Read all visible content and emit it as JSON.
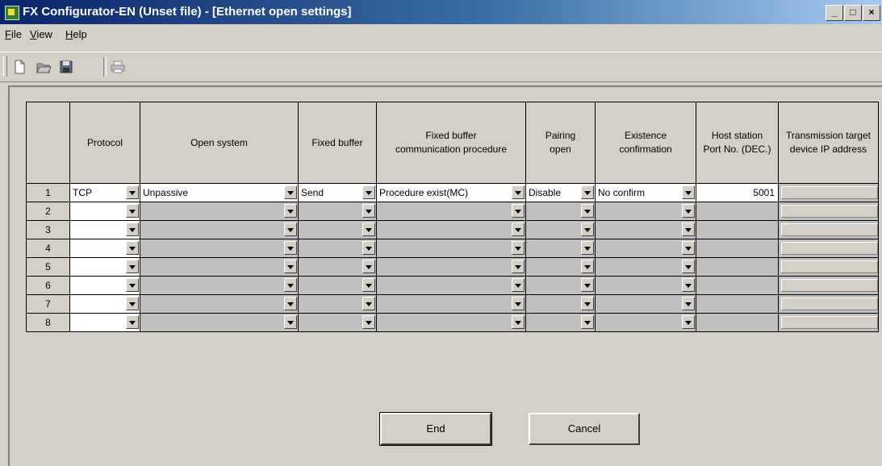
{
  "window": {
    "title": "FX Configurator-EN (Unset file) - [Ethernet open settings]"
  },
  "menu": [
    {
      "label_u": "F",
      "label_rest": "ile"
    },
    {
      "label_u": "V",
      "label_rest": "iew"
    },
    {
      "label_u": "H",
      "label_rest": "elp"
    }
  ],
  "table": {
    "headers": [
      "",
      "Protocol",
      "Open system",
      "Fixed buffer",
      "Fixed buffer communication procedure",
      "Pairing open",
      "Existence confirmation",
      "Host station Port No. (DEC.)",
      "Transmission target device IP address"
    ],
    "rows": [
      {
        "num": "1",
        "protocol": "TCP",
        "open_system": "Unpassive",
        "fixed_buffer": "Send",
        "procedure": "Procedure exist(MC)",
        "pairing": "Disable",
        "existence": "No confirm",
        "port": "5001"
      },
      {
        "num": "2",
        "protocol": "",
        "open_system": "",
        "fixed_buffer": "",
        "procedure": "",
        "pairing": "",
        "existence": "",
        "port": ""
      },
      {
        "num": "3",
        "protocol": "",
        "open_system": "",
        "fixed_buffer": "",
        "procedure": "",
        "pairing": "",
        "existence": "",
        "port": ""
      },
      {
        "num": "4",
        "protocol": "",
        "open_system": "",
        "fixed_buffer": "",
        "procedure": "",
        "pairing": "",
        "existence": "",
        "port": ""
      },
      {
        "num": "5",
        "protocol": "",
        "open_system": "",
        "fixed_buffer": "",
        "procedure": "",
        "pairing": "",
        "existence": "",
        "port": ""
      },
      {
        "num": "6",
        "protocol": "",
        "open_system": "",
        "fixed_buffer": "",
        "procedure": "",
        "pairing": "",
        "existence": "",
        "port": ""
      },
      {
        "num": "7",
        "protocol": "",
        "open_system": "",
        "fixed_buffer": "",
        "procedure": "",
        "pairing": "",
        "existence": "",
        "port": ""
      },
      {
        "num": "8",
        "protocol": "",
        "open_system": "",
        "fixed_buffer": "",
        "procedure": "",
        "pairing": "",
        "existence": "",
        "port": ""
      }
    ]
  },
  "buttons": {
    "end": "End",
    "cancel": "Cancel"
  },
  "toolbar_icons": [
    "new-file-icon",
    "open-folder-icon",
    "save-icon",
    "print-icon"
  ],
  "colors": {
    "title_start": "#0a246a",
    "title_end": "#a6caf0",
    "face": "#d4d0c8",
    "disabled_cell": "#c0c0c0"
  }
}
